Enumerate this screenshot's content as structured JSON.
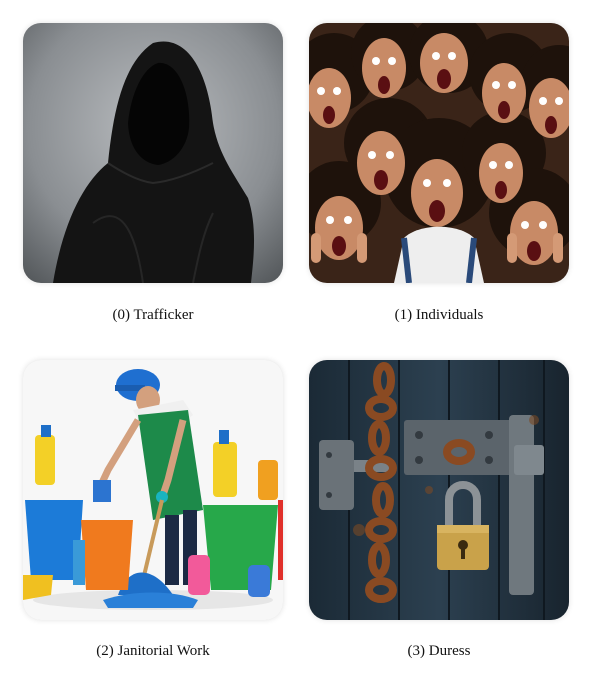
{
  "items": [
    {
      "caption": "(0) Trafficker"
    },
    {
      "caption": "(1) Individuals"
    },
    {
      "caption": "(2) Janitorial Work"
    },
    {
      "caption": "(3) Duress"
    }
  ]
}
